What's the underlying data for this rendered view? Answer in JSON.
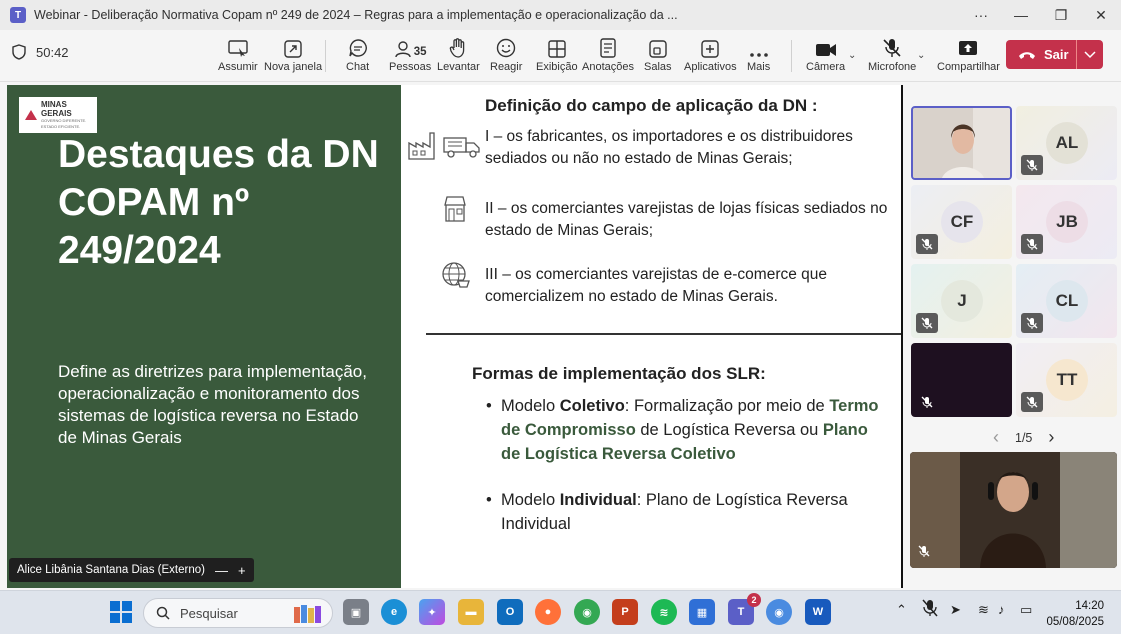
{
  "window": {
    "title": "Webinar - Deliberação Normativa Copam nº 249 de 2024 – Regras para a implementação e operacionalização da ...",
    "app_icon": "teams-icon",
    "more": "···"
  },
  "toolbar": {
    "timer": "50:42",
    "buttons": [
      {
        "label": "Assumir",
        "icon": "take-control-icon"
      },
      {
        "label": "Nova janela",
        "icon": "pop-out-icon"
      },
      {
        "label": "Chat",
        "icon": "chat-icon"
      },
      {
        "label": "Pessoas",
        "icon": "people-icon",
        "count": "35"
      },
      {
        "label": "Levantar",
        "icon": "raise-hand-icon"
      },
      {
        "label": "Reagir",
        "icon": "react-icon"
      },
      {
        "label": "Exibição",
        "icon": "view-icon"
      },
      {
        "label": "Anotações",
        "icon": "notes-icon"
      },
      {
        "label": "Salas",
        "icon": "rooms-icon"
      },
      {
        "label": "Aplicativos",
        "icon": "apps-icon"
      },
      {
        "label": "Mais",
        "icon": "more-icon"
      },
      {
        "label": "Câmera",
        "icon": "camera-icon"
      },
      {
        "label": "Microfone",
        "icon": "mic-off-icon"
      },
      {
        "label": "Compartilhar",
        "icon": "share-icon"
      }
    ],
    "leave_label": "Sair"
  },
  "share": {
    "logo_line1": "MINAS",
    "logo_line2": "GERAIS",
    "logo_small": "GOVERNO DIFERENTE. ESTADO EFICIENTE.",
    "title": "Destaques da DN COPAM nº 249/2024",
    "subtitle": "Define as diretrizes para implementação, operacionalização e monitoramento dos sistemas de logística reversa no Estado de Minas Gerais",
    "presenter_name": "Alice Libânia Santana Dias (Externo)",
    "presenter_minimize": "—",
    "presenter_add": "+",
    "slide": {
      "heading1": "Definição do campo de aplicação da DN :",
      "items": [
        "I – os fabricantes, os importadores e os distribuidores sediados ou não no estado de Minas Gerais;",
        "II – os comerciantes varejistas de lojas físicas sediados no estado de Minas Gerais;",
        "III – os comerciantes varejistas de e-comerce que comercializem no estado de Minas Gerais."
      ],
      "heading2": "Formas de implementação dos SLR:",
      "bullet": "•",
      "b1_a": "Modelo ",
      "b1_b": "Coletivo",
      "b1_c": ": Formalização por meio de ",
      "b1_d": "Termo de Compromisso",
      "b1_e": " de Logística Reversa ou ",
      "b1_f": "Plano de Logística Reversa Coletivo",
      "b2_a": "Modelo ",
      "b2_b": "Individual",
      "b2_c": ": Plano de Logística Reversa Individual"
    }
  },
  "gallery": {
    "participants": [
      "AL",
      "CF",
      "JB",
      "J",
      "CL",
      "TT"
    ],
    "pager": "1/5",
    "prev": "‹",
    "next": "›"
  },
  "taskbar": {
    "search_placeholder": "Pesquisar",
    "teams_badge": "2",
    "time": "14:20",
    "date": "05/08/2025"
  },
  "colors": {
    "green": "#3a5a3c",
    "leave": "#c4314b",
    "teams": "#5b5fc7"
  }
}
